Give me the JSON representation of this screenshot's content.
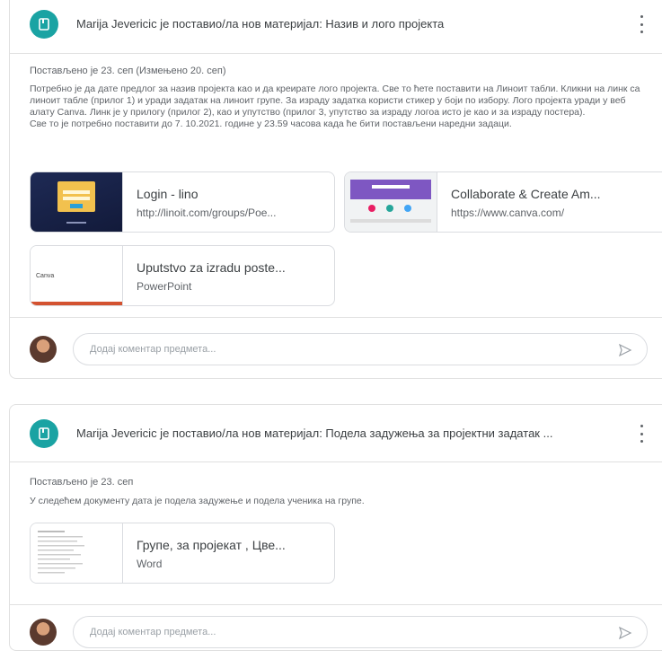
{
  "post1": {
    "title": "Marija Jevericic је поставио/ла нов материјал: Назив и лого пројекта",
    "posted": "Постављено је 23. сеп (Измењено 20. сеп)",
    "body": "Потребно је да дате предлог за назив пројекта као и да креирате лого пројекта. Све то ћете поставити на Линоит табли. Кликни на линк са линоит табле (прилог 1) и уради задатак на линоит групе. За израду задатка користи стикер у боји по избору. Лого пројекта уради у веб алату Canva. Линк је у прилогу (прилог 2), као и упутство (прилог 3, упутство за израду логоа исто је као и за израду постера).\nСве то је потребно поставити до 7. 10.2021. године у 23.59 часова када ће бити постављени наредни задаци.",
    "attachments": [
      {
        "title": "Login - lino",
        "subtitle": "http://linoit.com/groups/Poe..."
      },
      {
        "title": "Collaborate & Create Am...",
        "subtitle": "https://www.canva.com/"
      },
      {
        "title": "Uputstvo za izradu poste...",
        "subtitle": "PowerPoint",
        "thumb_text": "Canva"
      }
    ],
    "comment_placeholder": "Додај коментар предмета..."
  },
  "post2": {
    "title": "Marija Jevericic је поставио/ла нов материјал: Подела задужења за пројектни задатак ...",
    "posted": "Постављено је 23. сеп",
    "body": "У следећем документу дата је подела задужење и подела ученика на групе.",
    "attachments": [
      {
        "title": "Групе, за пројекат , Цве...",
        "subtitle": "Word"
      }
    ],
    "comment_placeholder": "Додај коментар предмета..."
  },
  "icons": {
    "post": "material-icon",
    "more": "more-vert-icon",
    "send": "send-icon"
  },
  "colors": {
    "accent": "#1aa3a3",
    "border": "#dadce0",
    "text": "#3c4043",
    "muted": "#5f6368"
  }
}
